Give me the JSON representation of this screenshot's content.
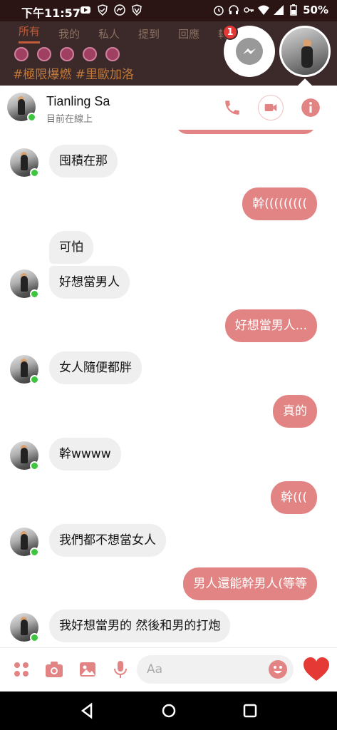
{
  "status_bar": {
    "time": "下午11:57",
    "battery": "50%"
  },
  "background_app": {
    "tabs": [
      "所有",
      "我的",
      "私人",
      "提到",
      "回應",
      "轉噗"
    ],
    "hashtags": "#極限爆燃 #里歐加洛"
  },
  "chat_heads": {
    "notification_count": "1"
  },
  "header": {
    "name": "Tianling Sa",
    "status": "目前在線上"
  },
  "messages": [
    {
      "side": "in",
      "text": "囤積在那"
    },
    {
      "side": "out",
      "text": "幹((((((((("
    },
    {
      "side": "in",
      "text": "可怕"
    },
    {
      "side": "in",
      "text": "好想當男人"
    },
    {
      "side": "out",
      "text": "好想當男人..."
    },
    {
      "side": "in",
      "text": "女人隨便都胖"
    },
    {
      "side": "out",
      "text": "真的"
    },
    {
      "side": "in",
      "text": "幹wwww"
    },
    {
      "side": "out",
      "text": "幹((("
    },
    {
      "side": "in",
      "text": "我們都不想當女人"
    },
    {
      "side": "out",
      "text": "男人還能幹男人(等等"
    },
    {
      "side": "in",
      "text": "我好想當男的 然後和男的打炮"
    }
  ],
  "composer": {
    "placeholder": "Aa"
  },
  "colors": {
    "accent": "#e38484",
    "online": "#3ec43e",
    "incoming_bubble": "#efefef"
  }
}
